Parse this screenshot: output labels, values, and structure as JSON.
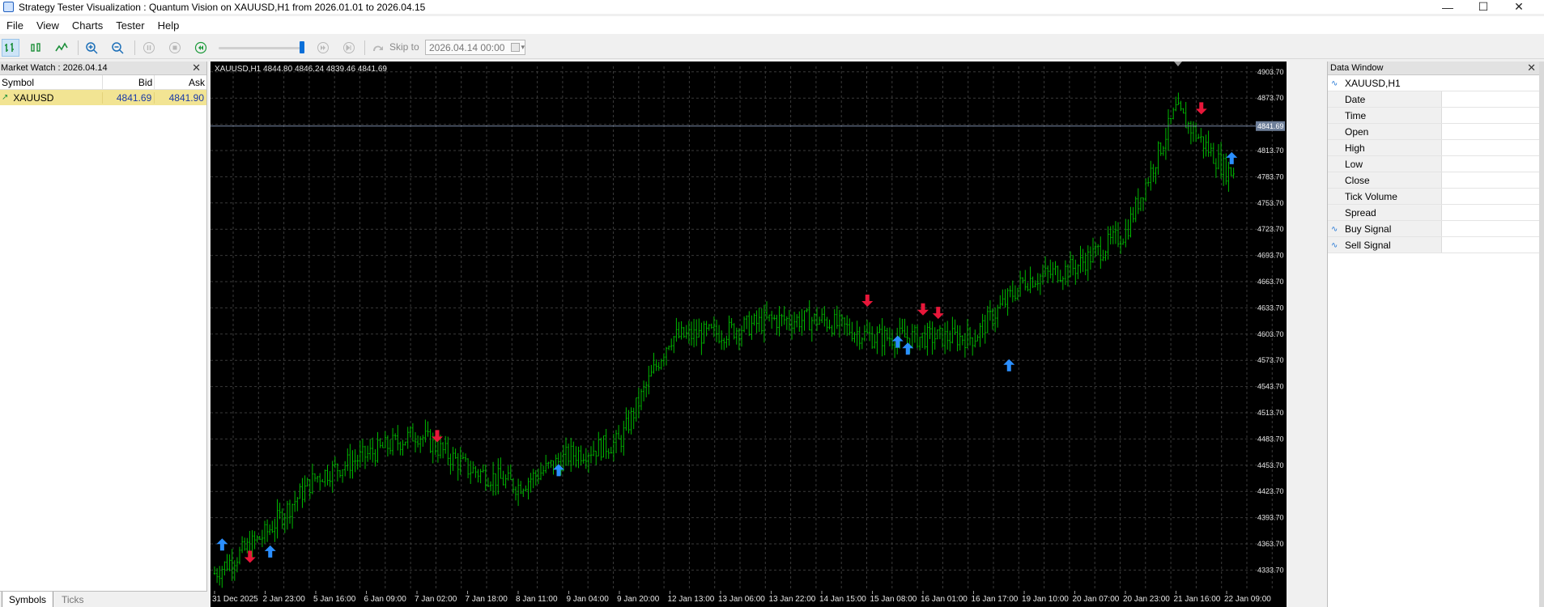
{
  "window": {
    "title": "Strategy Tester Visualization : Quantum Vision on XAUUSD,H1 from 2026.01.01 to 2026.04.15"
  },
  "menu": [
    "File",
    "View",
    "Charts",
    "Tester",
    "Help"
  ],
  "toolbar": {
    "skip_label": "Skip to",
    "skip_date": "2026.04.14 00:00",
    "speed_fraction": 0.96
  },
  "market_watch": {
    "title": "Market Watch : 2026.04.14",
    "columns": [
      "Symbol",
      "Bid",
      "Ask"
    ],
    "rows": [
      {
        "symbol": "XAUUSD",
        "bid": "4841.69",
        "ask": "4841.90"
      }
    ],
    "tabs": [
      "Symbols",
      "Ticks"
    ]
  },
  "chart": {
    "header": "XAUUSD,H1  4844.80 4846.24 4839.46 4841.69",
    "price_labels": [
      "4903.70",
      "4873.70",
      "4843.70",
      "4813.70",
      "4783.70",
      "4753.70",
      "4723.70",
      "4693.70",
      "4663.70",
      "4633.70",
      "4603.70",
      "4573.70",
      "4543.70",
      "4513.70",
      "4483.70",
      "4453.70",
      "4423.70",
      "4393.70",
      "4363.70",
      "4333.70"
    ],
    "current_price": "4841.69",
    "time_labels": [
      "31 Dec 2025",
      "2 Jan 23:00",
      "5 Jan 16:00",
      "6 Jan 09:00",
      "7 Jan 02:00",
      "7 Jan 18:00",
      "8 Jan 11:00",
      "9 Jan 04:00",
      "9 Jan 20:00",
      "12 Jan 13:00",
      "13 Jan 06:00",
      "13 Jan 22:00",
      "14 Jan 15:00",
      "15 Jan 08:00",
      "16 Jan 01:00",
      "16 Jan 17:00",
      "19 Jan 10:00",
      "20 Jan 07:00",
      "20 Jan 23:00",
      "21 Jan 16:00",
      "22 Jan 09:00"
    ],
    "colors": {
      "bars": "#00b800",
      "buy_arrow": "#2b8fff",
      "sell_arrow": "#e8173a",
      "grid": "#3a3a3a",
      "background": "#000000"
    }
  },
  "chart_data": {
    "type": "line",
    "title": "XAUUSD,H1",
    "xlabel": "",
    "ylabel": "",
    "ylim": [
      4310,
      4910
    ],
    "x_tick_labels": [
      "31 Dec 2025",
      "2 Jan 23:00",
      "5 Jan 16:00",
      "6 Jan 09:00",
      "7 Jan 02:00",
      "7 Jan 18:00",
      "8 Jan 11:00",
      "9 Jan 04:00",
      "9 Jan 20:00",
      "12 Jan 13:00",
      "13 Jan 06:00",
      "13 Jan 22:00",
      "14 Jan 15:00",
      "15 Jan 08:00",
      "16 Jan 01:00",
      "16 Jan 17:00",
      "19 Jan 10:00",
      "20 Jan 07:00",
      "20 Jan 23:00",
      "21 Jan 16:00",
      "22 Jan 09:00"
    ],
    "series": [
      {
        "name": "XAUUSD",
        "x": [
          0,
          1,
          2,
          3,
          4,
          5,
          6,
          7,
          8,
          9,
          10,
          11,
          12,
          13,
          14,
          15,
          16,
          17,
          18,
          19,
          20
        ],
        "values": [
          4330,
          4375,
          4440,
          4465,
          4490,
          4450,
          4430,
          4465,
          4480,
          4600,
          4605,
          4620,
          4620,
          4600,
          4600,
          4600,
          4665,
          4680,
          4720,
          4860,
          4790
        ]
      }
    ],
    "signals": {
      "buy": [
        {
          "x": 0.15,
          "y": 4370
        },
        {
          "x": 1.1,
          "y": 4362
        },
        {
          "x": 6.8,
          "y": 4455
        },
        {
          "x": 13.5,
          "y": 4602
        },
        {
          "x": 13.7,
          "y": 4594
        },
        {
          "x": 15.7,
          "y": 4575
        },
        {
          "x": 20.1,
          "y": 4812
        }
      ],
      "sell": [
        {
          "x": 0.7,
          "y": 4342
        },
        {
          "x": 4.4,
          "y": 4480
        },
        {
          "x": 12.9,
          "y": 4635
        },
        {
          "x": 14.0,
          "y": 4625
        },
        {
          "x": 14.3,
          "y": 4621
        },
        {
          "x": 19.5,
          "y": 4855
        }
      ]
    }
  },
  "data_window": {
    "title": "Data Window",
    "symbol": "XAUUSD,H1",
    "fields": [
      "Date",
      "Time",
      "Open",
      "High",
      "Low",
      "Close",
      "Tick Volume",
      "Spread",
      "Buy Signal",
      "Sell Signal"
    ]
  }
}
